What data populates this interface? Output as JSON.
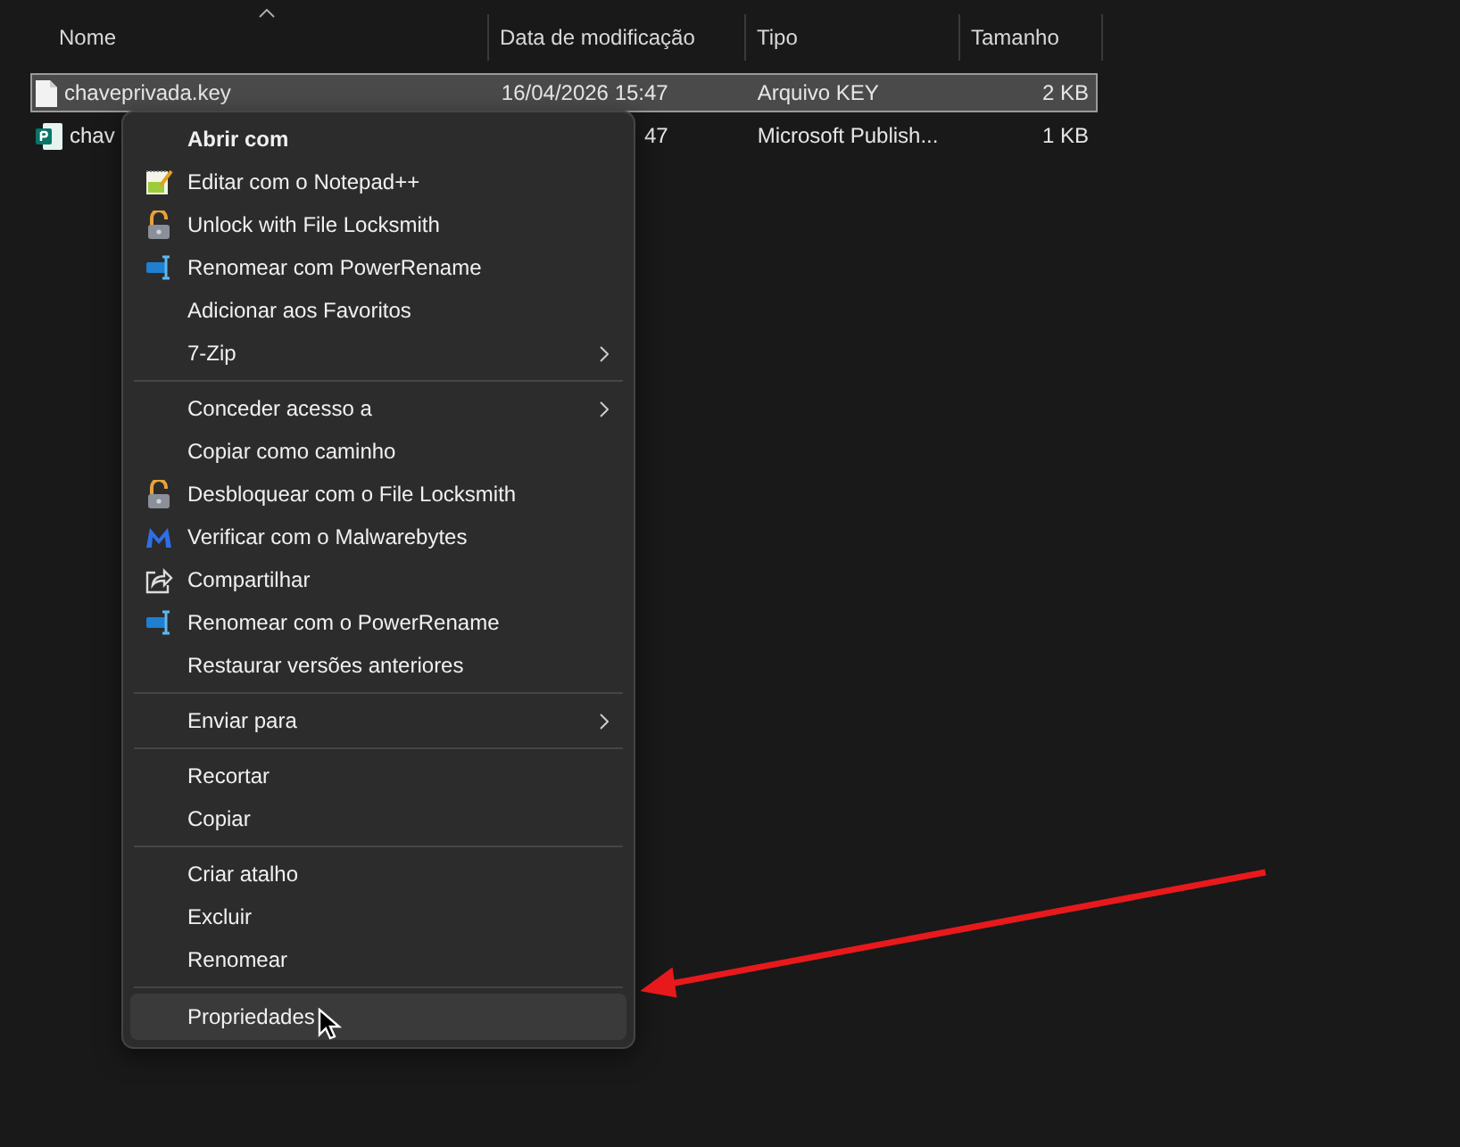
{
  "columns": [
    {
      "label": "Nome",
      "sorted": true
    },
    {
      "label": "Data de modificação",
      "sorted": false
    },
    {
      "label": "Tipo",
      "sorted": false
    },
    {
      "label": "Tamanho",
      "sorted": false
    }
  ],
  "rows": [
    {
      "name": "chaveprivada.key",
      "date": "16/04/2026 15:47",
      "type": "Arquivo KEY",
      "size": "2 KB",
      "selected": true
    },
    {
      "name": "chav",
      "date": "47",
      "type": "Microsoft Publish...",
      "size": "1 KB",
      "selected": false
    }
  ],
  "context_menu": {
    "items": [
      {
        "kind": "item",
        "label": "Abrir com",
        "bold": true,
        "submenu": false,
        "selected": false
      },
      {
        "kind": "item",
        "label": "Editar com o Notepad++",
        "submenu": false,
        "selected": false
      },
      {
        "kind": "item",
        "label": "Unlock with File Locksmith",
        "submenu": false,
        "selected": false
      },
      {
        "kind": "item",
        "label": "Renomear com PowerRename",
        "submenu": false,
        "selected": false
      },
      {
        "kind": "item",
        "label": "Adicionar aos Favoritos",
        "submenu": false,
        "selected": false
      },
      {
        "kind": "item",
        "label": "7-Zip",
        "submenu": true,
        "selected": false
      },
      {
        "kind": "separator"
      },
      {
        "kind": "item",
        "label": "Conceder acesso a",
        "submenu": true,
        "selected": false
      },
      {
        "kind": "item",
        "label": "Copiar como caminho",
        "submenu": false,
        "selected": false
      },
      {
        "kind": "item",
        "label": "Desbloquear com o File Locksmith",
        "submenu": false,
        "selected": false
      },
      {
        "kind": "item",
        "label": "Verificar com o Malwarebytes",
        "submenu": false,
        "selected": false
      },
      {
        "kind": "item",
        "label": "Compartilhar",
        "submenu": false,
        "selected": false
      },
      {
        "kind": "item",
        "label": "Renomear com o PowerRename",
        "submenu": false,
        "selected": false
      },
      {
        "kind": "item",
        "label": "Restaurar versões anteriores",
        "submenu": false,
        "selected": false
      },
      {
        "kind": "separator"
      },
      {
        "kind": "item",
        "label": "Enviar para",
        "submenu": true,
        "selected": false
      },
      {
        "kind": "separator"
      },
      {
        "kind": "item",
        "label": "Recortar",
        "submenu": false,
        "selected": false
      },
      {
        "kind": "item",
        "label": "Copiar",
        "submenu": false,
        "selected": false
      },
      {
        "kind": "separator"
      },
      {
        "kind": "item",
        "label": "Criar atalho",
        "submenu": false,
        "selected": false
      },
      {
        "kind": "item",
        "label": "Excluir",
        "submenu": false,
        "selected": false
      },
      {
        "kind": "item",
        "label": "Renomear",
        "submenu": false,
        "selected": false
      },
      {
        "kind": "separator"
      },
      {
        "kind": "item",
        "label": "Propriedades",
        "submenu": false,
        "selected": true
      }
    ]
  }
}
